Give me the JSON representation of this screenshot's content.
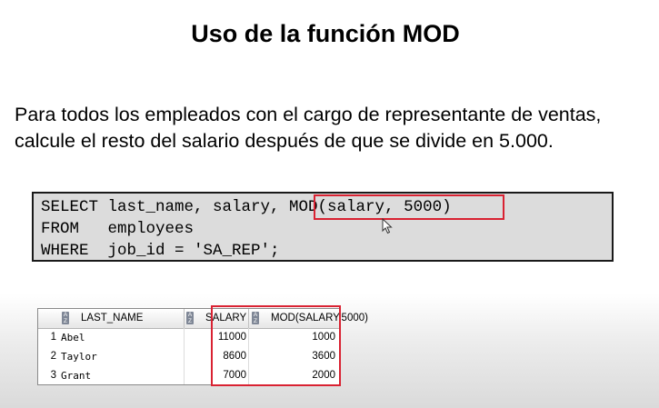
{
  "slide": {
    "title": "Uso de la función MOD",
    "paragraph": "Para todos los empleados con el cargo de representante de ventas, calcule el resto del salario después de que se divide en 5.000."
  },
  "sql": {
    "line1_prefix": "SELECT last_name, salary, ",
    "line1_highlight": "MOD(salary, 5000)",
    "line2": "FROM   employees",
    "line3": "WHERE  job_id = 'SA_REP';"
  },
  "result_grid": {
    "columns": [
      "LAST_NAME",
      "SALARY",
      "MOD(SALARY,5000)"
    ],
    "rows": [
      {
        "num": "1",
        "last_name": "Abel",
        "salary": "11000",
        "mod": "1000"
      },
      {
        "num": "2",
        "last_name": "Taylor",
        "salary": "8600",
        "mod": "3600"
      },
      {
        "num": "3",
        "last_name": "Grant",
        "salary": "7000",
        "mod": "2000"
      }
    ],
    "sort_icon": "sort-az-icon"
  },
  "colors": {
    "highlight": "#d92232",
    "code_background": "#dcdcdc"
  }
}
